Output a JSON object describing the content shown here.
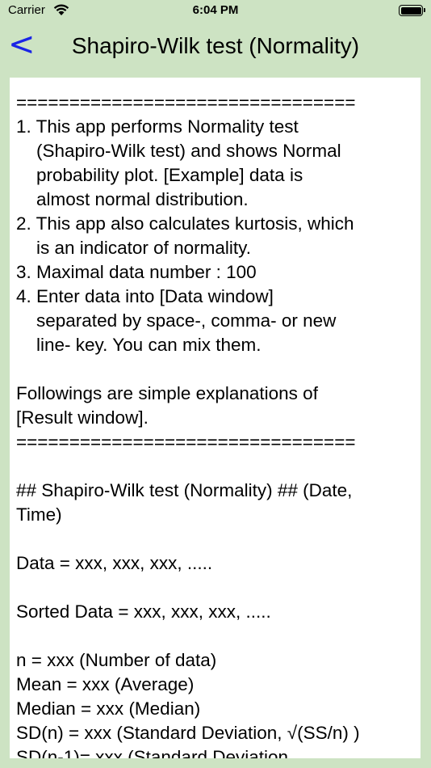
{
  "status_bar": {
    "carrier": "Carrier",
    "time": "6:04 PM"
  },
  "nav": {
    "back_label": "<",
    "title": "Shapiro-Wilk test (Normality)"
  },
  "content": {
    "text": "================================\n1. This app performs Normality test\n    (Shapiro-Wilk test) and shows Normal\n    probability plot. [Example] data is\n    almost normal distribution.\n2. This app also calculates kurtosis, which\n    is an indicator of normality.\n3. Maximal data number : 100\n4. Enter data into [Data window]\n    separated by space-, comma- or new\n    line- key. You can mix them.\n\nFollowings are simple explanations of\n[Result window].\n================================\n\n## Shapiro-Wilk test (Normality) ## (Date,\nTime)\n\nData = xxx, xxx, xxx, .....\n\nSorted Data = xxx, xxx, xxx, .....\n\nn = xxx (Number of data)\nMean = xxx (Average)\nMedian = xxx (Median)\nSD(n) = xxx (Standard Deviation, √(SS/n) )\nSD(n-1)= xxx (Standard Deviation"
  }
}
